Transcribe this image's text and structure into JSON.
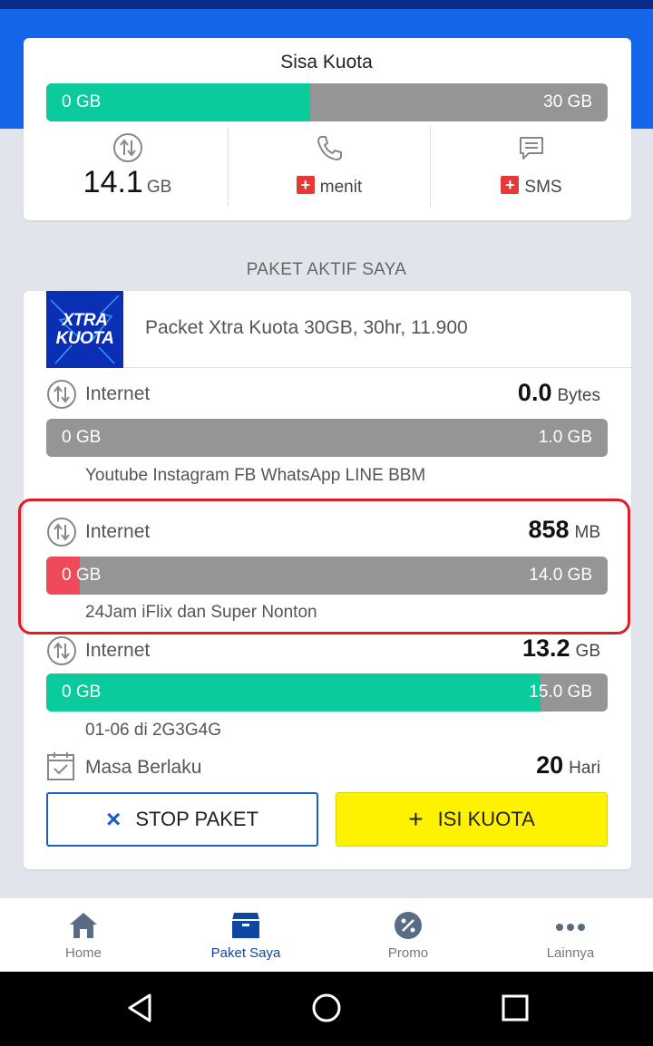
{
  "quota": {
    "title": "Sisa Kuota",
    "bar": {
      "left": "0 GB",
      "right": "30 GB",
      "fill_fraction": 0.47,
      "fill_color": "#0acb9b"
    },
    "internet": {
      "value": "14.1",
      "unit": "GB"
    },
    "phone": {
      "label": "menit",
      "badge": "+"
    },
    "sms": {
      "label": "SMS",
      "badge": "+"
    }
  },
  "section_title": "PAKET AKTIF SAYA",
  "package": {
    "logo": {
      "line1": "XTRA",
      "line2": "KUOTA"
    },
    "name": "Packet Xtra Kuota 30GB, 30hr, 11.900",
    "rows": [
      {
        "label": "Internet",
        "value": "0.0",
        "unit": "Bytes",
        "bar_left": "0 GB",
        "bar_right": "1.0 GB",
        "fill_fraction": 0,
        "fill_color": "#0acb9b",
        "note": "Youtube Instagram FB WhatsApp LINE BBM"
      },
      {
        "label": "Internet",
        "value": "858",
        "unit": "MB",
        "bar_left": "0 GB",
        "bar_right": "14.0 GB",
        "fill_fraction": 0.06,
        "fill_color": "#ee4a5a",
        "note": "24Jam iFlix dan Super Nonton"
      },
      {
        "label": "Internet",
        "value": "13.2",
        "unit": "GB",
        "bar_left": "0 GB",
        "bar_right": "15.0 GB",
        "fill_fraction": 0.88,
        "fill_color": "#0acb9b",
        "note": "01-06 di 2G3G4G"
      }
    ],
    "validity": {
      "label": "Masa Berlaku",
      "value": "20",
      "unit": "Hari"
    }
  },
  "buttons": {
    "stop": {
      "icon": "×",
      "label": "STOP PAKET"
    },
    "isi": {
      "icon": "+",
      "label": "ISI KUOTA"
    }
  },
  "nav": {
    "items": [
      {
        "label": "Home",
        "icon": "home-icon"
      },
      {
        "label": "Paket Saya",
        "icon": "package-icon",
        "active": true
      },
      {
        "label": "Promo",
        "icon": "promo-icon"
      },
      {
        "label": "Lainnya",
        "icon": "more-icon"
      }
    ]
  },
  "colors": {
    "header_blue": "#1565e8",
    "green": "#0acb9b",
    "red": "#ee4a5a",
    "yellow": "#fff200",
    "active_nav": "#0d47a1"
  }
}
